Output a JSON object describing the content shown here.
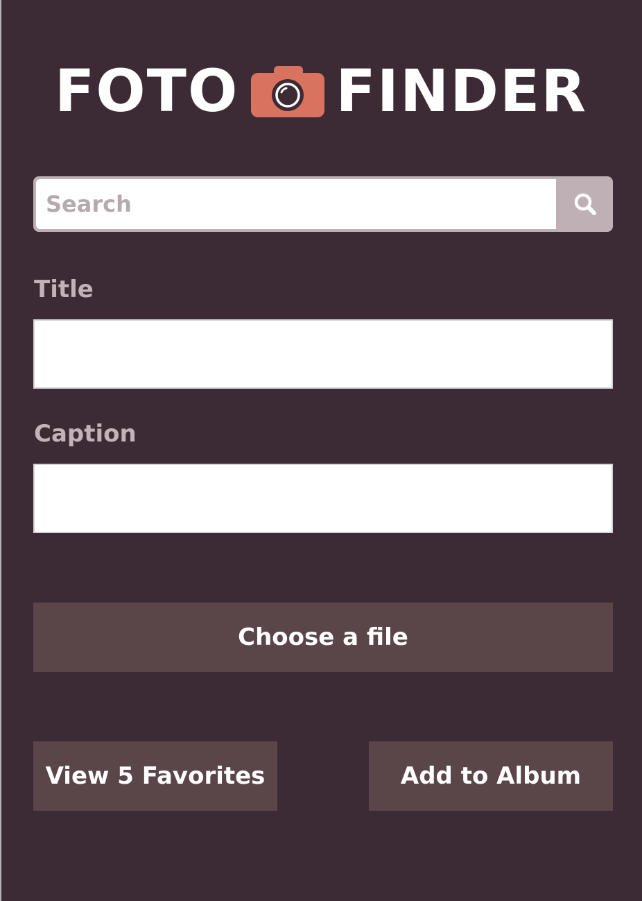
{
  "brand": {
    "word_left": "FOTO",
    "word_right": "FINDER",
    "camera_icon": "camera-icon",
    "accent_color": "#d9735f",
    "background_color": "#3c2b35"
  },
  "search": {
    "placeholder": "Search",
    "value": "",
    "button_icon": "search-icon"
  },
  "form": {
    "title_label": "Title",
    "title_value": "",
    "caption_label": "Caption",
    "caption_value": ""
  },
  "actions": {
    "choose_file_label": "Choose a file",
    "view_favorites_label": "View 5 Favorites",
    "add_to_album_label": "Add to Album",
    "button_color": "#5a4548"
  }
}
